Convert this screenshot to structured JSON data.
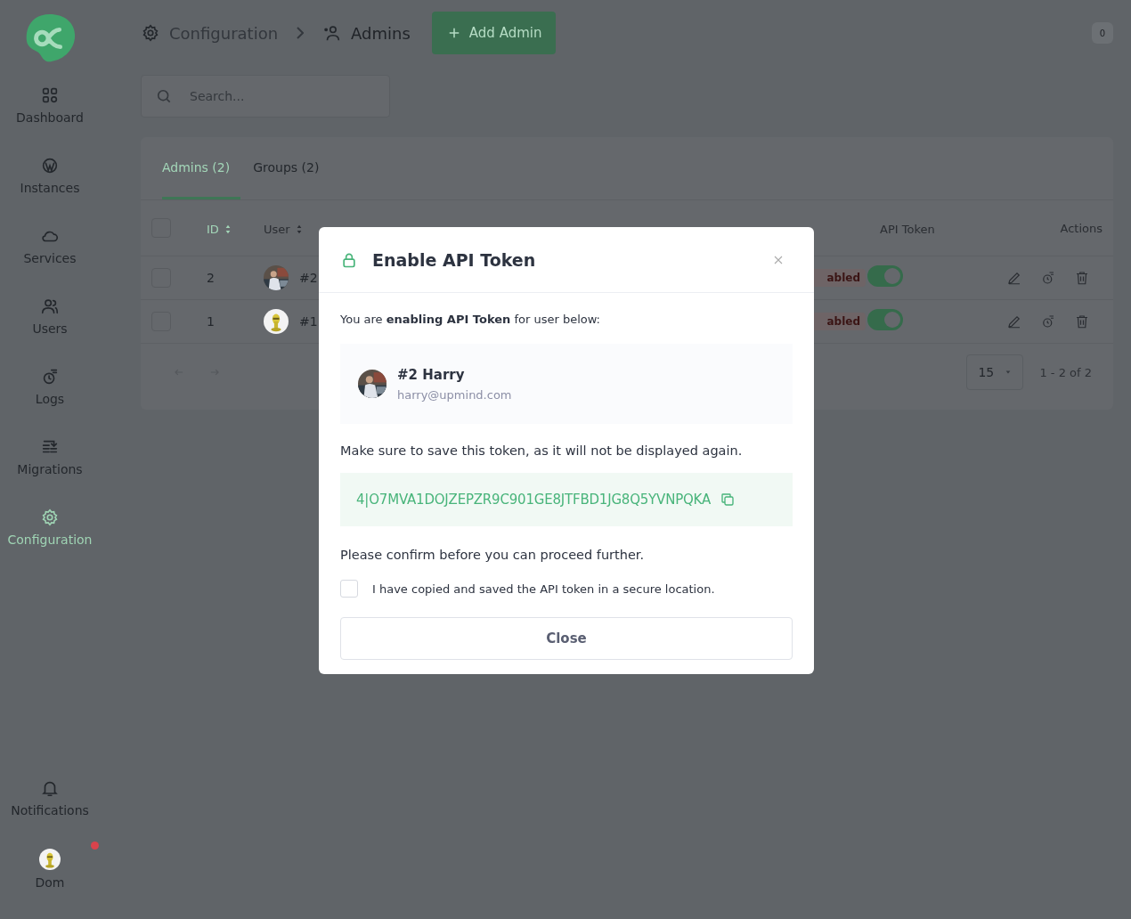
{
  "sidebar": {
    "items": [
      {
        "label": "Dashboard",
        "selected": false
      },
      {
        "label": "Instances",
        "selected": false
      },
      {
        "label": "Services",
        "selected": false
      },
      {
        "label": "Users",
        "selected": false
      },
      {
        "label": "Logs",
        "selected": false
      },
      {
        "label": "Migrations",
        "selected": false
      },
      {
        "label": "Configuration",
        "selected": true
      }
    ],
    "bottom": [
      {
        "label": "Notifications",
        "kind": "bell",
        "dot": false
      },
      {
        "label": "Dom",
        "kind": "avatar",
        "dot": true
      }
    ]
  },
  "header": {
    "breadcrumb": [
      "Configuration",
      "Admins"
    ],
    "add_button": "Add Admin",
    "badge": "0"
  },
  "search": {
    "placeholder": "Search..."
  },
  "tabs": [
    {
      "label": "Admins (2)",
      "selected": true
    },
    {
      "label": "Groups (2)",
      "selected": false
    }
  ],
  "table": {
    "header_checked": false,
    "columns": [
      {
        "label": "ID",
        "sortable": true,
        "sorted": true
      },
      {
        "label": "User",
        "sortable": true,
        "sorted": false
      },
      {
        "label": "API Token",
        "sortable": false,
        "sorted": false
      },
      {
        "label": "Actions",
        "sortable": false,
        "sorted": false
      }
    ],
    "rows": [
      {
        "id": "2",
        "user": "#2",
        "status": "abled",
        "api_token": true,
        "checked": false
      },
      {
        "id": "1",
        "user": "#1",
        "status": "abled",
        "api_token": true,
        "checked": false
      }
    ],
    "page_size": "15",
    "range": "1 - 2 of 2"
  },
  "modal": {
    "title": "Enable API Token",
    "intro": "You are **enabling API Token** for user below:",
    "user_name": "#2 Harry",
    "user_email": "harry@upmind.com",
    "warning": "Make sure to save this token, as it will not be displayed again.",
    "token": "4|O7MVA1DOJZEPZR9C901GE8JTFBD1JG8Q5YVNPQKA",
    "confirm_heading": "Please confirm before you can proceed further.",
    "confirm_label": "I have copied and saved the API token in a secure location.",
    "confirm_checked": false,
    "close_button": "Close"
  }
}
